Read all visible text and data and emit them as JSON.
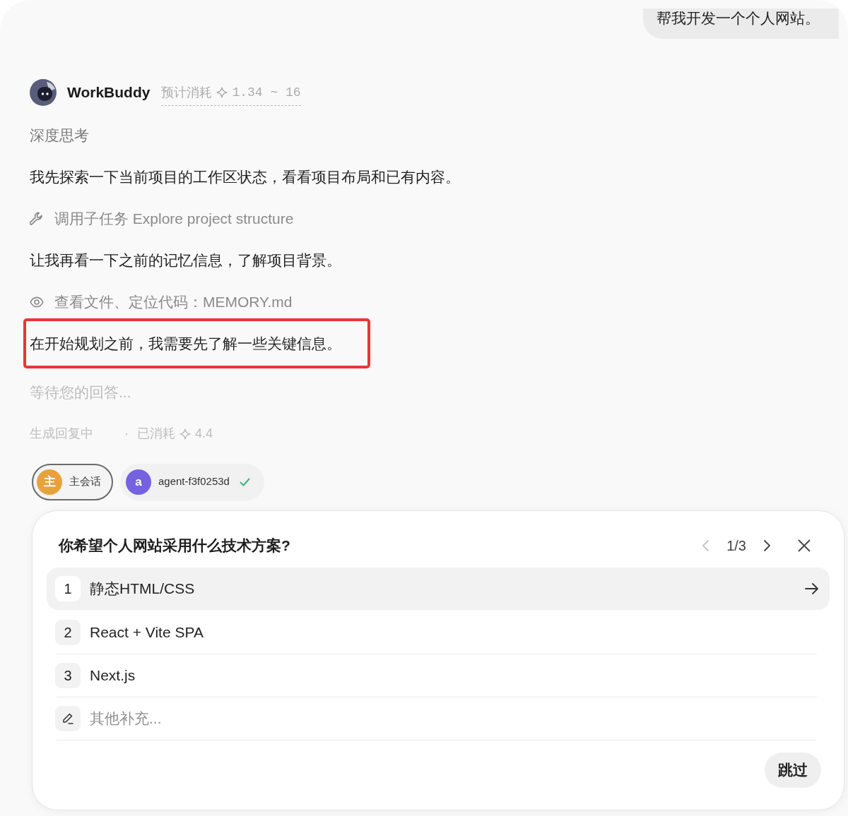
{
  "user_message": {
    "text": "帮我开发一个个人网站。"
  },
  "assistant": {
    "name": "WorkBuddy",
    "estimate_label": "预计消耗",
    "estimate_value": "1.34 ~ 16"
  },
  "messages": [
    {
      "kind": "thinking",
      "text": "深度思考",
      "highlighted": false
    },
    {
      "kind": "text",
      "text": "我先探索一下当前项目的工作区状态，看看项目布局和已有内容。",
      "highlighted": false
    },
    {
      "kind": "subtask",
      "text": "调用子任务 Explore project structure",
      "highlighted": false
    },
    {
      "kind": "text",
      "text": "让我再看一下之前的记忆信息，了解项目背景。",
      "highlighted": false
    },
    {
      "kind": "file_view",
      "text": "查看文件、定位代码：MEMORY.md",
      "highlighted": false
    },
    {
      "kind": "text",
      "text": "在开始规划之前，我需要先了解一些关键信息。",
      "highlighted": true
    },
    {
      "kind": "waiting",
      "text": "等待您的回答...",
      "highlighted": false
    }
  ],
  "status": {
    "label": "生成回复中",
    "separator": "·",
    "spent_label": "已消耗",
    "spent_value": "4.4"
  },
  "sessions": [
    {
      "avatar": "主",
      "label": "主会话",
      "color": "#e8a23b",
      "selected": true,
      "done": false
    },
    {
      "avatar": "a",
      "label": "agent-f3f0253d",
      "color": "#7562e0",
      "selected": false,
      "done": true
    }
  ],
  "question": {
    "title": "你希望个人网站采用什么技术方案?",
    "page": "1/3",
    "previous_disabled": true,
    "options": [
      {
        "kind": "choice",
        "number": "1",
        "label": "静态HTML/CSS",
        "selected": true
      },
      {
        "kind": "choice",
        "number": "2",
        "label": "React + Vite SPA",
        "selected": false
      },
      {
        "kind": "choice",
        "number": "3",
        "label": "Next.js",
        "selected": false
      },
      {
        "kind": "input",
        "placeholder": "其他补充..."
      }
    ],
    "skip_button": "跳过"
  }
}
